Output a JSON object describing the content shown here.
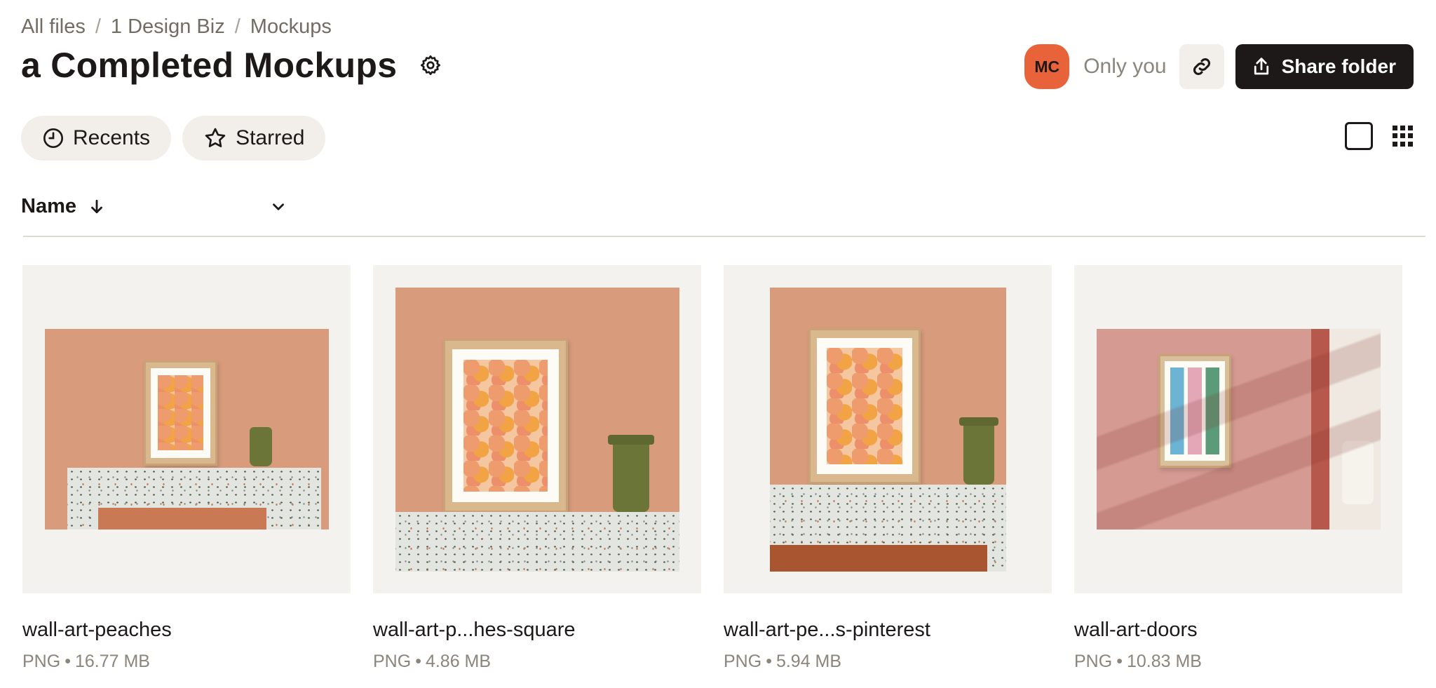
{
  "breadcrumb": {
    "items": [
      "All files",
      "1 Design Biz",
      "Mockups"
    ],
    "separator": "/"
  },
  "header": {
    "title": "a Completed Mockups",
    "avatar_initials": "MC",
    "avatar_color": "#e8623a",
    "sharing_status": "Only you",
    "share_label": "Share folder"
  },
  "filters": {
    "recents_label": "Recents",
    "starred_label": "Starred"
  },
  "sort": {
    "label": "Name",
    "direction": "descending"
  },
  "files": [
    {
      "name": "wall-art-peaches",
      "type": "PNG",
      "size": "16.77 MB"
    },
    {
      "name": "wall-art-p...hes-square",
      "type": "PNG",
      "size": "4.86 MB"
    },
    {
      "name": "wall-art-pe...s-pinterest",
      "type": "PNG",
      "size": "5.94 MB"
    },
    {
      "name": "wall-art-doors",
      "type": "PNG",
      "size": "10.83 MB"
    }
  ],
  "colors": {
    "accent": "#1e1919",
    "chip_bg": "#f2eeea",
    "thumb_bg": "#f4f2ef"
  }
}
